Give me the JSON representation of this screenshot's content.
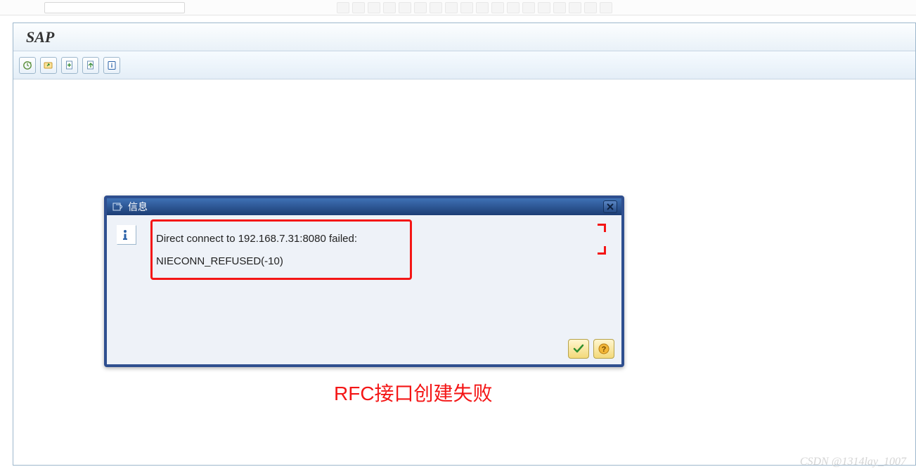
{
  "app": {
    "title": "SAP"
  },
  "toolbar": {
    "icons": [
      "clock-refresh-icon",
      "folder-arrow-icon",
      "doc-plus-icon",
      "doc-arrow-icon",
      "info-icon"
    ]
  },
  "dialog": {
    "title": "信息",
    "message_line1": "Direct connect to 192.168.7.31:8080 failed:",
    "message_line2": "NIECONN_REFUSED(-10)",
    "ok_label": "✓",
    "help_label": "?"
  },
  "annotation": {
    "caption": "RFC接口创建失败"
  },
  "watermark": "CSDN @1314lay_1007"
}
